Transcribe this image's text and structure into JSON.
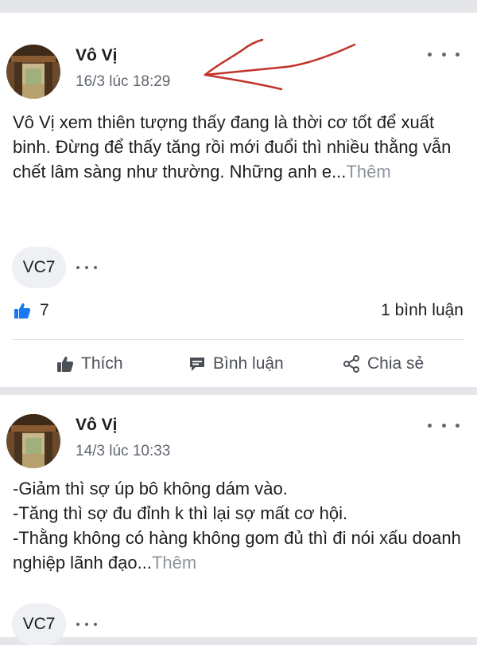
{
  "posts": [
    {
      "author": "Vô Vị",
      "time": "16/3 lúc 18:29",
      "text": "Vô Vị xem thiên tượng thấy đang là thời cơ tốt để xuất binh. Đừng để thấy tăng rồi mới đuổi thì nhiều thằng vẫn chết lâm sàng như thường. Những anh e...",
      "more_label": "Thêm",
      "group_tag": "VC7",
      "likes": "7",
      "comments": "1 bình luận",
      "actions": {
        "like": "Thích",
        "comment": "Bình luận",
        "share": "Chia sẻ"
      }
    },
    {
      "author": "Vô Vị",
      "time": "14/3 lúc 10:33",
      "lines": [
        "-Giảm thì sợ úp bô không dám vào.",
        "-Tăng thì sợ đu đỉnh k thì lại sợ mất cơ hội.",
        "-Thằng không có hàng không gom đủ thì đi nói xấu doanh nghiệp lãnh đạo..."
      ],
      "more_label": "Thêm",
      "group_tag": "VC7"
    }
  ],
  "icons": {
    "more": "more-horizontal-icon",
    "like_reaction": "thumbs-up-icon",
    "like": "thumbs-up-outline-icon",
    "comment": "comment-icon",
    "share": "share-icon",
    "annotation": "red-arrow-annotation"
  },
  "colors": {
    "like_blue": "#1877f2",
    "annotation_red": "#c0332b",
    "muted": "#8d949e"
  }
}
